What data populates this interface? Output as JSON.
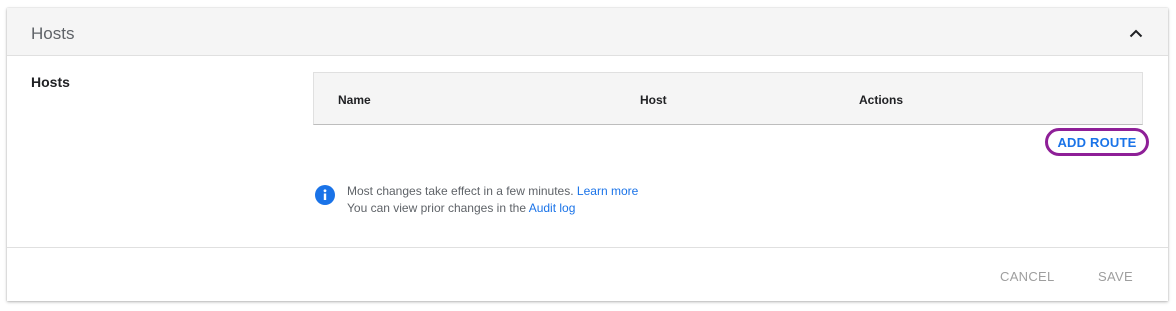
{
  "panel": {
    "title": "Hosts",
    "collapse_icon": "chevron-up-icon"
  },
  "section": {
    "label": "Hosts"
  },
  "table": {
    "columns": [
      "Name",
      "Host",
      "Actions"
    ]
  },
  "add_route_label": "ADD ROUTE",
  "info": {
    "icon": "info-icon",
    "line1_text": "Most changes take effect in a few minutes.",
    "line1_link": "Learn more",
    "line2_text": "You can view prior changes in the",
    "line2_link": "Audit log"
  },
  "footer": {
    "cancel_label": "CANCEL",
    "save_label": "SAVE"
  },
  "colors": {
    "accent": "#1a73e8",
    "highlight": "#8e1f97",
    "disabled": "#9e9e9e"
  }
}
